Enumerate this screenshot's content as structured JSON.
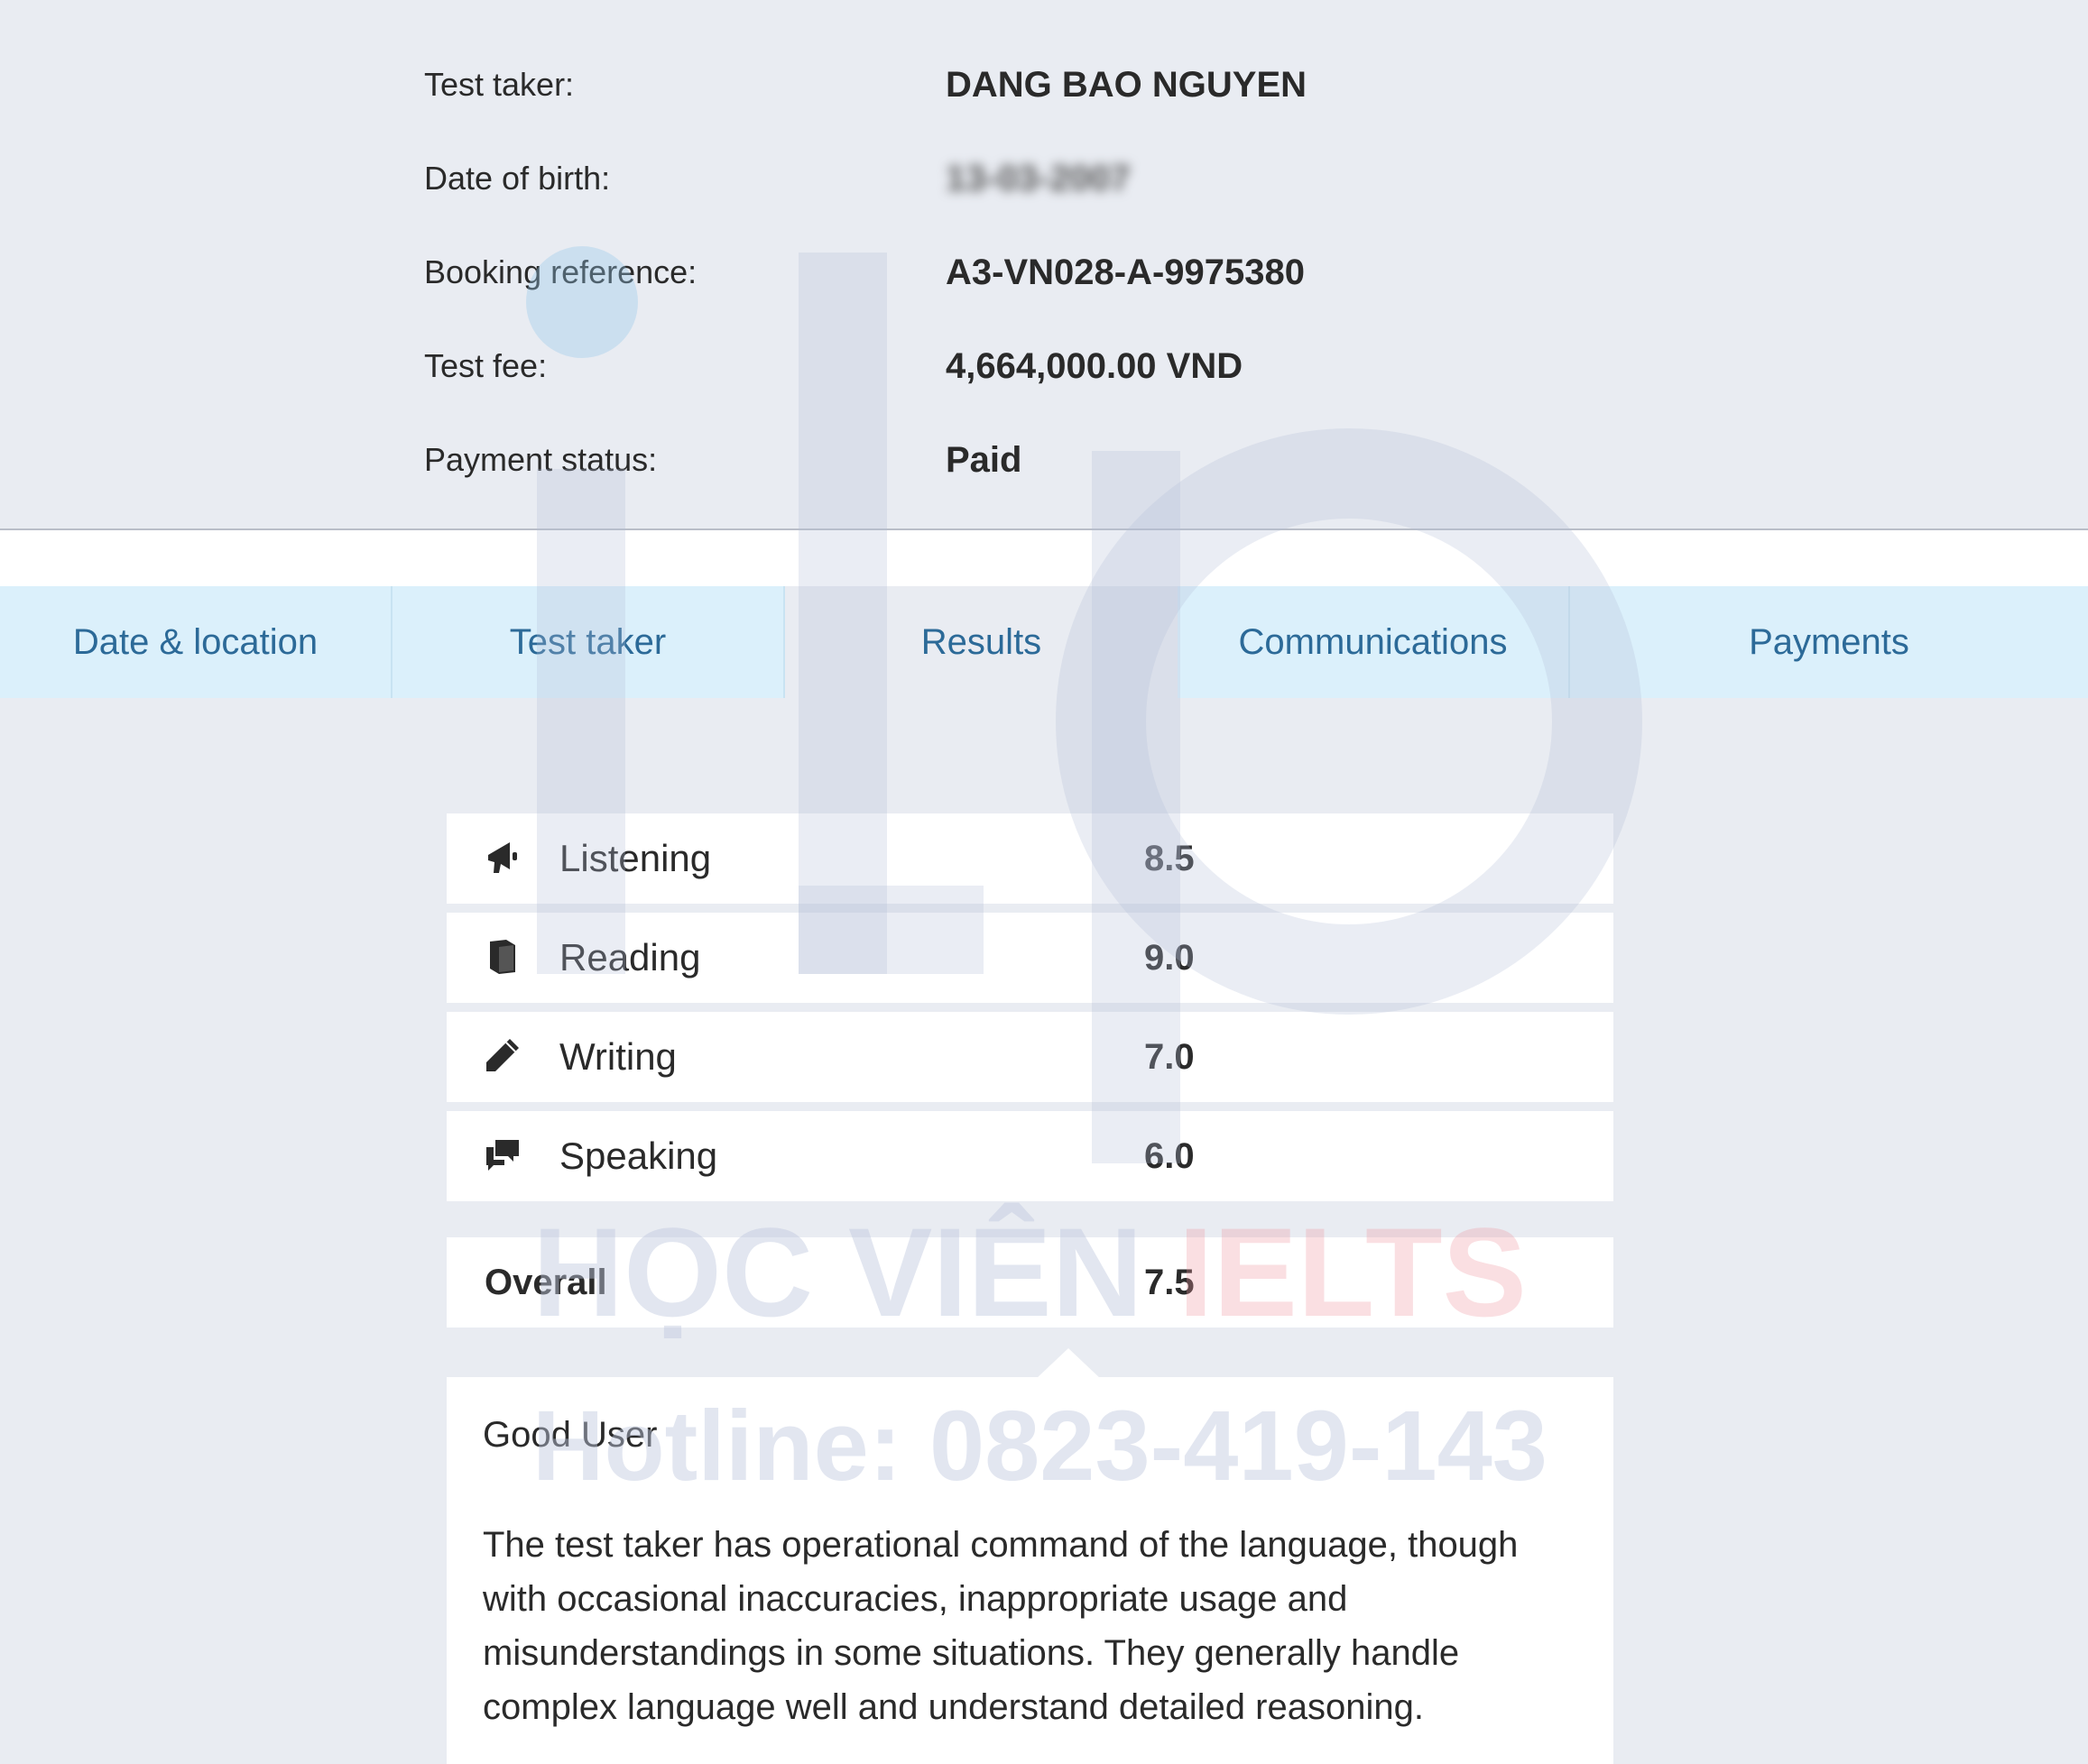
{
  "summary": {
    "rows": [
      {
        "label": "Test taker:",
        "value": "DANG BAO NGUYEN"
      },
      {
        "label": "Date of birth:",
        "value": "13-03-2007"
      },
      {
        "label": "Booking reference:",
        "value": "A3-VN028-A-9975380"
      },
      {
        "label": "Test fee:",
        "value": "4,664,000.00 VND"
      },
      {
        "label": "Payment status:",
        "value": "Paid"
      }
    ]
  },
  "tabs": [
    {
      "label": "Date & location"
    },
    {
      "label": "Test taker"
    },
    {
      "label": "Results"
    },
    {
      "label": "Communications"
    },
    {
      "label": "Payments"
    }
  ],
  "active_tab": "Results",
  "scores": [
    {
      "skill": "Listening",
      "band": "8.5",
      "icon": "megaphone-icon"
    },
    {
      "skill": "Reading",
      "band": "9.0",
      "icon": "book-icon"
    },
    {
      "skill": "Writing",
      "band": "7.0",
      "icon": "pencil-icon"
    },
    {
      "skill": "Speaking",
      "band": "6.0",
      "icon": "speech-bubbles-icon"
    }
  ],
  "overall": {
    "label": "Overall",
    "band": "7.5"
  },
  "description": {
    "title": "Good User",
    "text": "The test taker has operational command of the language, though with occasional inaccuracies, inappropriate usage and misunderstandings in some situations. They generally handle complex language well and understand detailed reasoning."
  },
  "watermark": {
    "brand_part1": "HỌC VIÊN ",
    "brand_part2": "IELTS",
    "hotline": "Hotline: 0823-419-143"
  },
  "colors": {
    "background": "#e9ecf2",
    "tab_background": "#dbf0fb",
    "tab_text": "#2c6a98",
    "card_background": "#ffffff"
  }
}
